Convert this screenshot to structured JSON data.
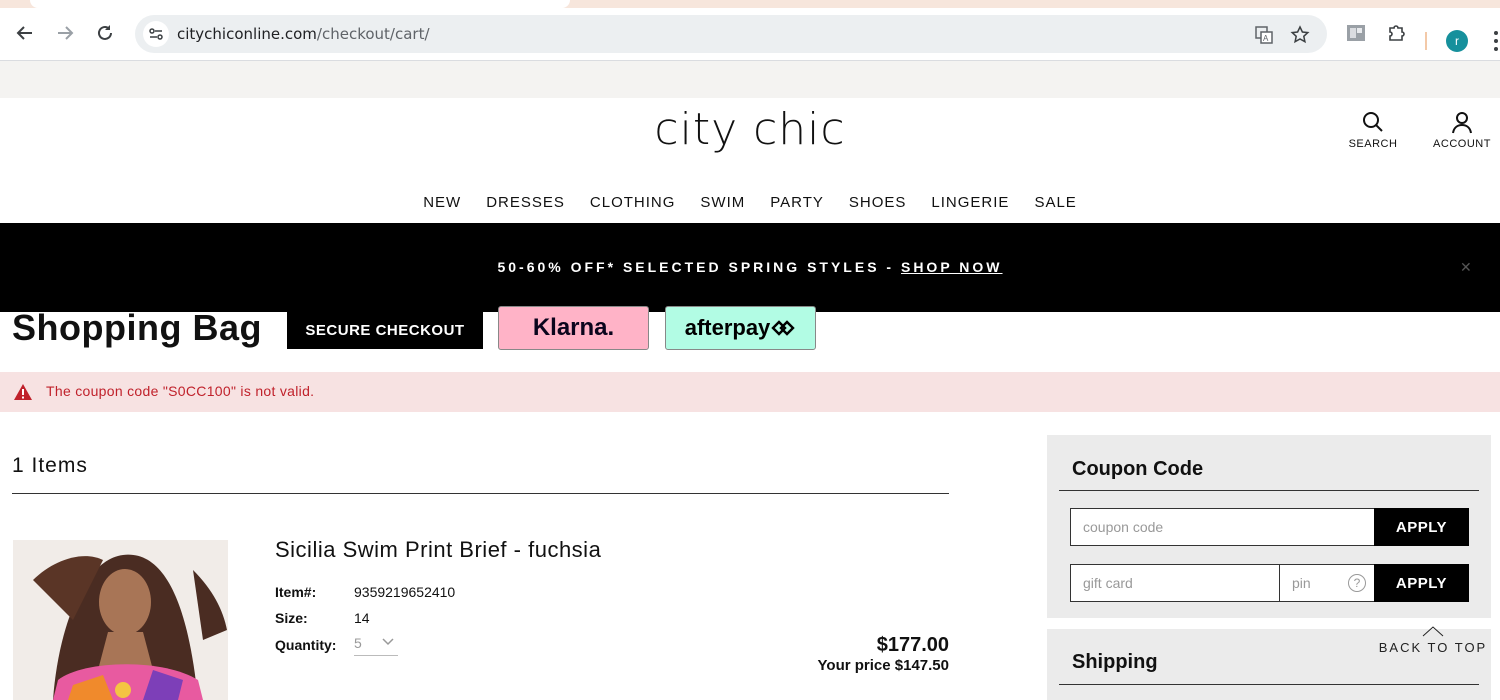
{
  "browser": {
    "url_domain": "citychiconline.com",
    "url_path": "/checkout/cart/",
    "profile_initial": "r"
  },
  "site": {
    "logo": "city chic",
    "search_label": "SEARCH",
    "account_label": "ACCOUNT",
    "nav": [
      "NEW",
      "DRESSES",
      "CLOTHING",
      "SWIM",
      "PARTY",
      "SHOES",
      "LINGERIE",
      "SALE"
    ]
  },
  "promo": {
    "text": "50-60% OFF* SELECTED SPRING STYLES - ",
    "link": "SHOP NOW",
    "close": "✕"
  },
  "bag": {
    "title": "Shopping Bag",
    "secure_checkout": "SECURE CHECKOUT",
    "klarna": "Klarna.",
    "afterpay": "afterpay"
  },
  "alert": {
    "message": "The coupon code \"S0CC100\" is not valid."
  },
  "cart": {
    "items_heading": "1 Items",
    "product": {
      "name": "Sicilia Swim Print Brief - fuchsia",
      "item_label": "Item#:",
      "item_value": "9359219652410",
      "size_label": "Size:",
      "size_value": "14",
      "qty_label": "Quantity:",
      "qty_value": "5",
      "price": "$177.00",
      "your_price": "Your price $147.50"
    }
  },
  "sidebar": {
    "coupon_heading": "Coupon Code",
    "coupon_placeholder": "coupon code",
    "apply_label": "APPLY",
    "gift_placeholder": "gift card",
    "pin_placeholder": "pin",
    "help_glyph": "?",
    "apply2_label": "APPLY",
    "shipping_heading": "Shipping"
  },
  "back_to_top": "BACK TO TOP"
}
